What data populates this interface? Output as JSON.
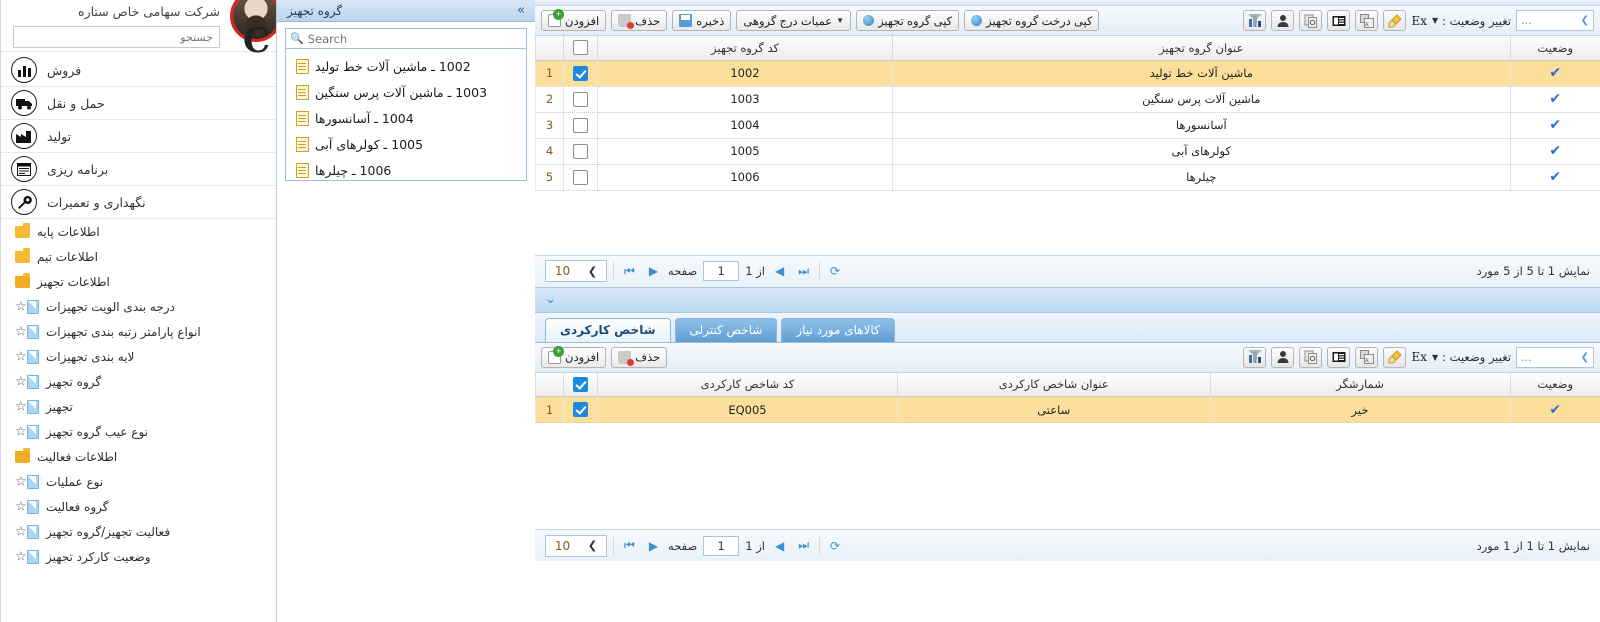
{
  "header": {
    "company": "شرکت سهامی خاص ستاره",
    "logo_letter": "C",
    "search_placeholder": "جستجو",
    "avatar_name": "avatar"
  },
  "sidebar": {
    "main_items": [
      {
        "label": "فروش",
        "icon": "chart-icon"
      },
      {
        "label": "حمل و نقل",
        "icon": "truck-icon"
      },
      {
        "label": "تولید",
        "icon": "factory-icon"
      },
      {
        "label": "برنامه ریزی",
        "icon": "calendar-icon"
      },
      {
        "label": "نگهداری و تعمیرات",
        "icon": "wrench-icon"
      }
    ],
    "nodes": [
      {
        "type": "folder",
        "label": "اطلاعات پایه",
        "open": false
      },
      {
        "type": "folder",
        "label": "اطلاعات تیم",
        "open": false
      },
      {
        "type": "folder",
        "label": "اطلاعات تجهیز",
        "open": true
      },
      {
        "type": "leaf",
        "label": "درجه بندی الویت تجهیزات",
        "star": "☆"
      },
      {
        "type": "leaf",
        "label": "انواع پارامتر رتبه بندی تجهیزات",
        "star": "☆"
      },
      {
        "type": "leaf",
        "label": "لایه بندی تجهیزات",
        "star": "☆"
      },
      {
        "type": "leaf",
        "label": "گروه تجهیز",
        "star": "☆"
      },
      {
        "type": "leaf",
        "label": "تجهیز",
        "star": "☆"
      },
      {
        "type": "leaf",
        "label": "نوع عیب گروه تجهیز",
        "star": "☆"
      },
      {
        "type": "folder",
        "label": "اطلاعات فعالیت",
        "open": true
      },
      {
        "type": "leaf",
        "label": "نوع عملیات",
        "star": "☆"
      },
      {
        "type": "leaf",
        "label": "گروه فعالیت",
        "star": "☆"
      },
      {
        "type": "leaf",
        "label": "فعالیت تجهیز/گروه تجهیز",
        "star": "☆"
      },
      {
        "type": "leaf",
        "label": "وضعیت کارکرد تجهیز",
        "star": "☆"
      }
    ]
  },
  "tree_panel": {
    "title": "گروه تجهیز",
    "collapse_icon": "»",
    "search_placeholder": "Search",
    "search_value": "",
    "items": [
      {
        "label": "1002 ـ ماشین آلات خط تولید"
      },
      {
        "label": "1003 ـ ماشین آلات پرس سنگین"
      },
      {
        "label": "1004 ـ آسانسورها"
      },
      {
        "label": "1005 ـ کولرهای آبی"
      },
      {
        "label": "1006 ـ چیلرها"
      }
    ]
  },
  "top_panel": {
    "toolbar": {
      "add_label": "افزودن",
      "delete_label": "حذف",
      "save_label": "ذخیره",
      "batch_label": "عمیات درج گروهی",
      "copy_group_label": "کپی گروه تجهیز",
      "copy_tree_label": "کپی درخت گروه تجهیز",
      "status_change_label": "تغییر وضعیت :",
      "status_value": "",
      "dots": "...",
      "ex_label": "Ex",
      "icons": [
        "highlighter-icon",
        "translate-icon",
        "card-view-icon",
        "copy-paste-icon",
        "user-icon",
        "chart-filter-icon"
      ]
    },
    "grid": {
      "columns": [
        "",
        "کد گروه تجهیز",
        "عنوان گروه تجهیز",
        "وضعیت"
      ],
      "rows": [
        {
          "num": "1",
          "checked": true,
          "code": "1002",
          "title": "ماشین آلات خط تولید",
          "status": "✔",
          "selected": true
        },
        {
          "num": "2",
          "checked": false,
          "code": "1003",
          "title": "ماشین آلات پرس سنگین",
          "status": "✔",
          "selected": false
        },
        {
          "num": "3",
          "checked": false,
          "code": "1004",
          "title": "آسانسورها",
          "status": "✔",
          "selected": false
        },
        {
          "num": "4",
          "checked": false,
          "code": "1005",
          "title": "کولرهای آبی",
          "status": "✔",
          "selected": false
        },
        {
          "num": "5",
          "checked": false,
          "code": "1006",
          "title": "چیلرها",
          "status": "✔",
          "selected": false
        }
      ]
    },
    "pager": {
      "page_size": "10",
      "page_label": "صفحه",
      "page_value": "1",
      "of_label": "از 1",
      "summary": "نمایش 1 تا 5 از 5 مورد",
      "refresh_icon": "refresh-icon"
    }
  },
  "bottom_panel": {
    "collapse_icon": "⌄",
    "tabs": [
      {
        "label": "شاخص کارکردی",
        "active": true
      },
      {
        "label": "شاخص کنترلی",
        "active": false
      },
      {
        "label": "کالاهای مورد نیاز",
        "active": false
      }
    ],
    "toolbar": {
      "add_label": "افزودن",
      "delete_label": "حذف",
      "status_change_label": "تغییر وضعیت :",
      "status_value": "",
      "dots": "...",
      "ex_label": "Ex",
      "icons": [
        "highlighter-icon",
        "translate-icon",
        "card-view-icon",
        "copy-paste-icon",
        "user-icon",
        "chart-filter-icon"
      ]
    },
    "grid": {
      "columns": [
        "",
        "کد شاخص کارکردی",
        "عنوان شاخص کارکردی",
        "شمارشگر",
        "وضعیت"
      ],
      "header_checked": true,
      "rows": [
        {
          "num": "1",
          "checked": true,
          "code": "EQ005",
          "title": "ساعتی",
          "counter": "خیر",
          "status": "✔",
          "selected": true
        }
      ]
    },
    "pager": {
      "page_size": "10",
      "page_label": "صفحه",
      "page_value": "1",
      "of_label": "از 1",
      "summary": "نمایش 1 تا 1 از 1 مورد",
      "refresh_icon": "refresh-icon"
    }
  },
  "colors": {
    "accent": "#1b8ae0",
    "selected_row": "#fbdf9b",
    "header_band": "#bdd9f2",
    "folder": "#f5bb35",
    "avatar_ring": "#e02020"
  }
}
